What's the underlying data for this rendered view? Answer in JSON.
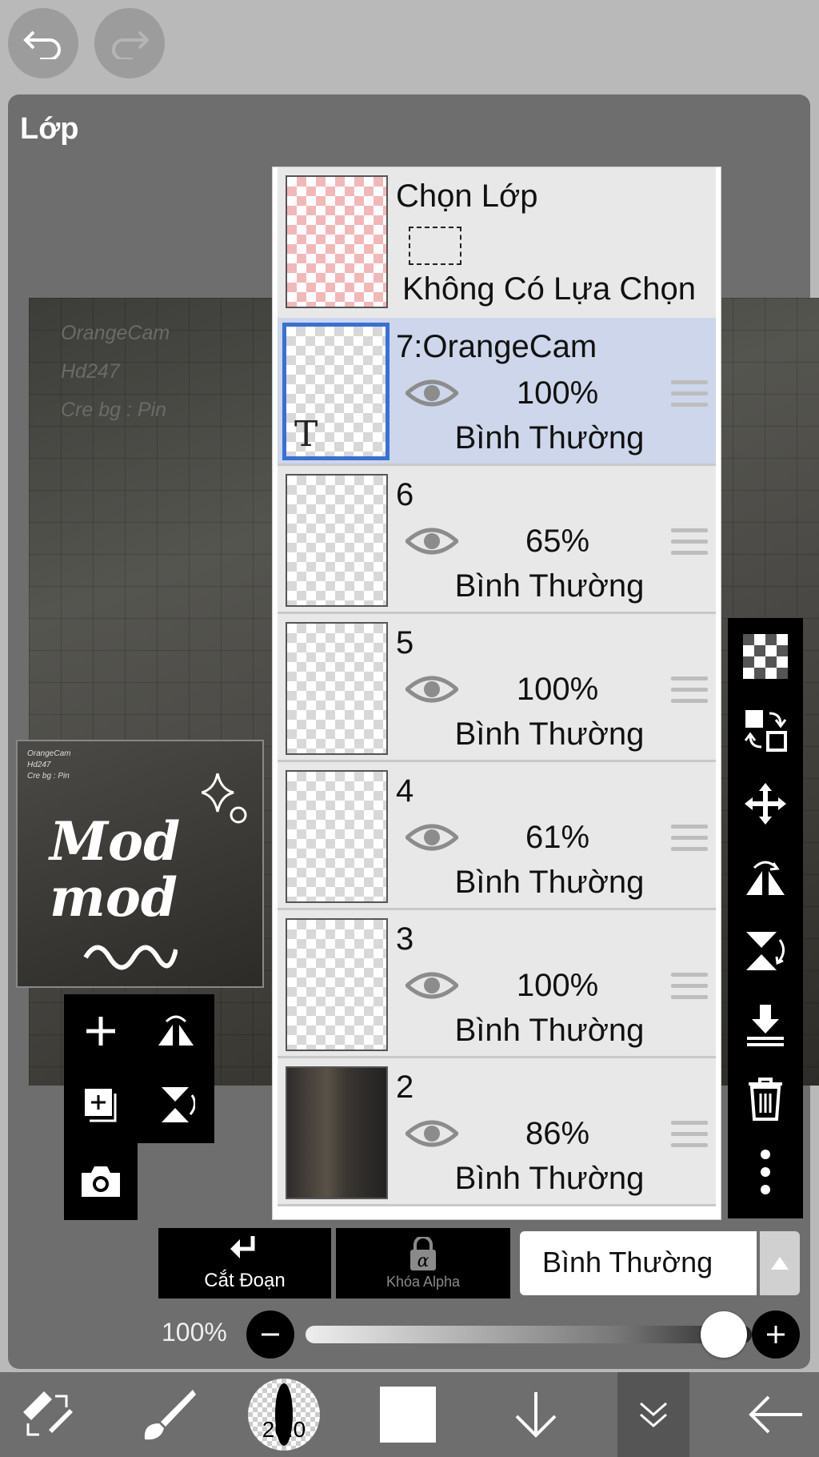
{
  "panel": {
    "title": "Lớp"
  },
  "canvas": {
    "credits": [
      "OrangeCam",
      "Hd247",
      "Cre bg : Pin"
    ]
  },
  "selection_row": {
    "title": "Chọn Lớp",
    "status": "Không Có Lựa Chọn"
  },
  "layers": [
    {
      "name": "7:OrangeCam",
      "opacity": "100%",
      "mode": "Bình Thường",
      "selected": true,
      "thumb": "text"
    },
    {
      "name": "6",
      "opacity": "65%",
      "mode": "Bình Thường",
      "selected": false,
      "thumb": "transparent"
    },
    {
      "name": "5",
      "opacity": "100%",
      "mode": "Bình Thường",
      "selected": false,
      "thumb": "transparent"
    },
    {
      "name": "4",
      "opacity": "61%",
      "mode": "Bình Thường",
      "selected": false,
      "thumb": "transparent"
    },
    {
      "name": "3",
      "opacity": "100%",
      "mode": "Bình Thường",
      "selected": false,
      "thumb": "transparent"
    },
    {
      "name": "2",
      "opacity": "86%",
      "mode": "Bình Thường",
      "selected": false,
      "thumb": "photo"
    }
  ],
  "preview": {
    "credits": [
      "OrangeCam",
      "Hd247",
      "Cre bg : Pin"
    ],
    "art_text": "Mod mod"
  },
  "bottom_controls": {
    "clipping_label": "Cắt Đoạn",
    "alpha_lock_label": "Khóa Alpha",
    "blend_mode": "Bình Thường",
    "opacity_label": "100%",
    "opacity_value": 1.0
  },
  "toolbar": {
    "brush_size": "20.0"
  },
  "colors": {
    "selected_layer": "#cdd6ea",
    "selected_border": "#3a6fd6",
    "panel": "#6e6e6e"
  }
}
